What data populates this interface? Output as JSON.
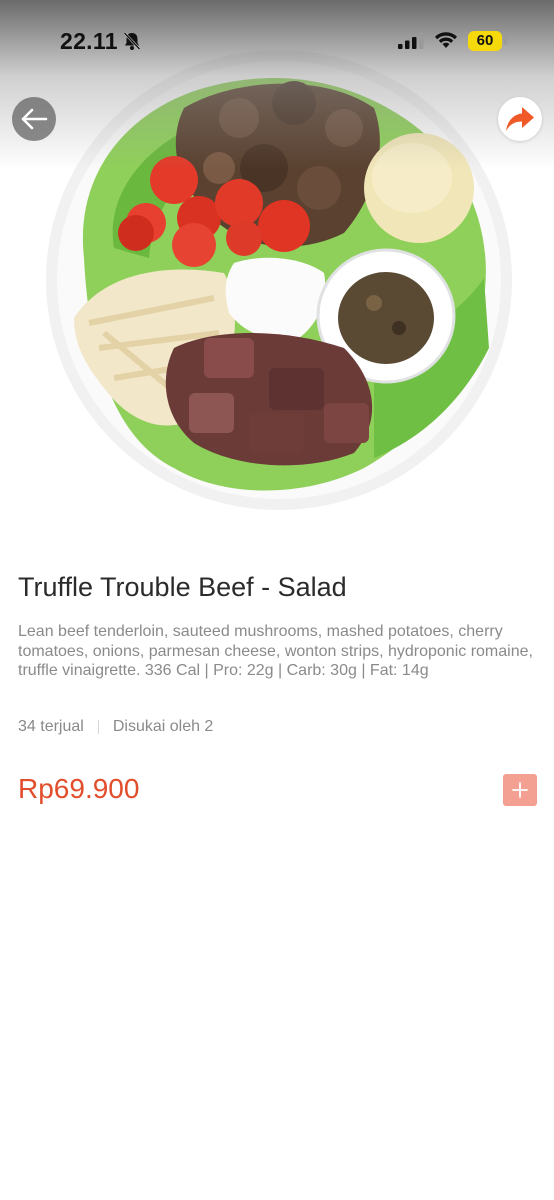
{
  "status_bar": {
    "time": "22.11",
    "battery": "60",
    "icons": [
      "bell-slash-icon",
      "signal-icon",
      "wifi-icon",
      "battery-icon"
    ]
  },
  "header": {
    "back_icon": "arrow-left-icon",
    "share_icon": "share-arrow-icon",
    "accent_color": "#f05a28"
  },
  "product": {
    "title": "Truffle Trouble Beef - Salad",
    "description": "Lean beef tenderloin, sauteed mushrooms, mashed potatoes, cherry tomatoes, onions, parmesan cheese, wonton strips, hydroponic romaine, truffle vinaigrette. 336 Cal | Pro: 22g | Carb: 30g | Fat: 14g",
    "sold": "34 terjual",
    "liked": "Disukai oleh 2",
    "price": "Rp69.900",
    "price_color": "#e24e2b",
    "add_icon": "plus-icon"
  }
}
